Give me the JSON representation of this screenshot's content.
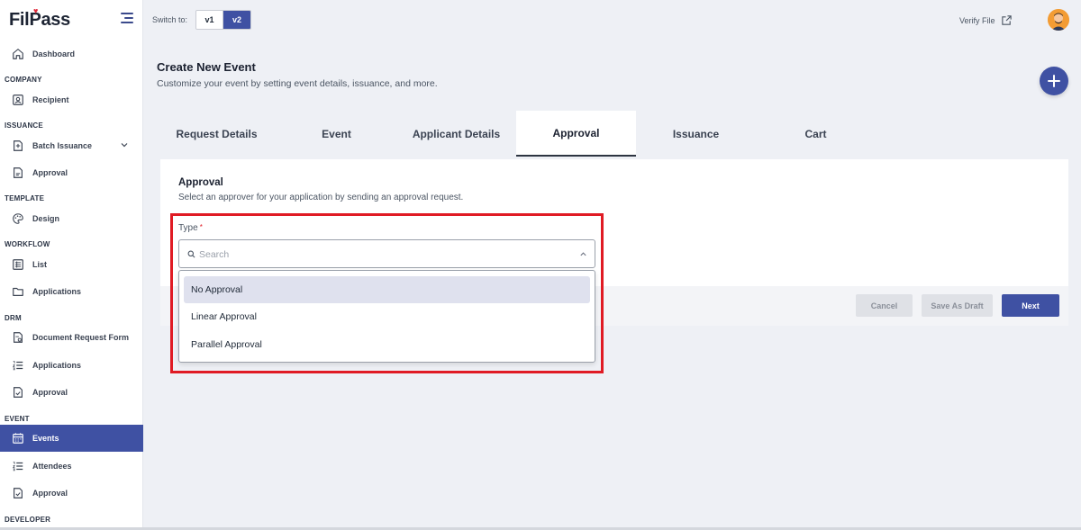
{
  "brand": {
    "name_part1": "Fil",
    "name_part2": "Pass"
  },
  "topbar": {
    "switch_label": "Switch to:",
    "versions": [
      "v1",
      "v2"
    ],
    "active_version": "v2",
    "verify_label": "Verify File"
  },
  "sidebar": {
    "top_item": "Dashboard",
    "sections": {
      "company": "COMPANY",
      "issuance": "ISSUANCE",
      "template": "TEMPLATE",
      "workflow": "WORKFLOW",
      "drm": "DRM",
      "event": "EVENT",
      "developer": "DEVELOPER"
    },
    "items": {
      "recipient": "Recipient",
      "batch_issuance": "Batch Issuance",
      "issuance_approval": "Approval",
      "design": "Design",
      "list": "List",
      "workflow_applications": "Applications",
      "document_request_form": "Document Request Form",
      "drm_applications": "Applications",
      "drm_approval": "Approval",
      "events": "Events",
      "attendees": "Attendees",
      "event_approval": "Approval"
    },
    "active_item": "Events"
  },
  "page": {
    "title": "Create New Event",
    "subtitle": "Customize your event by setting event details, issuance, and more."
  },
  "tabs": [
    "Request Details",
    "Event",
    "Applicant Details",
    "Approval",
    "Issuance",
    "Cart"
  ],
  "active_tab": "Approval",
  "approval": {
    "title": "Approval",
    "subtitle": "Select an approver for your application by sending an approval request.",
    "type_label": "Type",
    "required_mark": "*",
    "search_placeholder": "Search",
    "options": [
      "No Approval",
      "Linear Approval",
      "Parallel Approval"
    ],
    "highlighted_option": "No Approval"
  },
  "footer_buttons": {
    "cancel": "Cancel",
    "save_draft": "Save As Draft",
    "next": "Next"
  },
  "colors": {
    "primary": "#3f51a3",
    "highlight_border": "#e01b24",
    "background": "#eef0f5"
  }
}
